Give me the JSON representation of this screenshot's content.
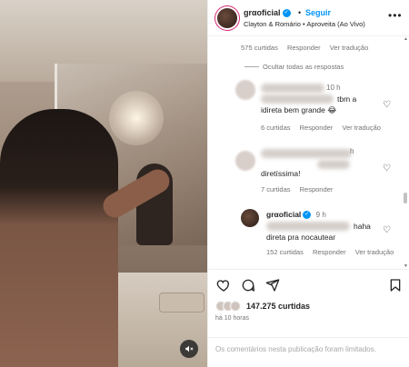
{
  "post": {
    "username": "grαoficial",
    "verified_mark": "✓",
    "separator": "•",
    "follow_label": "Seguir",
    "song": "Clayton & Romário • Aproveita (Ao Vivo)",
    "more_glyph": "•••"
  },
  "comments": {
    "prev_meta": {
      "likes": "575 curtidas",
      "reply": "Responder",
      "translate": "Ver tradução"
    },
    "hide_replies_label": "Ocultar todas as respostas",
    "items": [
      {
        "time": "10 h",
        "text_line1": "tbm a",
        "text_line2": "idireta bem grande 😂",
        "likes": "6 curtidas",
        "reply": "Responder",
        "translate": "Ver tradução"
      },
      {
        "time": "h",
        "text": "diretíssima!",
        "likes": "7 curtidas",
        "reply": "Responder"
      },
      {
        "username": "grαoficial",
        "verified_mark": "✓",
        "time": "9 h",
        "text_line1": "haha",
        "text_line2": "direta pra nocautear",
        "likes": "152 curtidas",
        "reply": "Responder",
        "translate": "Ver tradução"
      }
    ]
  },
  "actions": {
    "likes_count": "147.275 curtidas",
    "time_ago": "há 10 horas",
    "comments_limited": "Os comentários nesta publicação foram limitados."
  },
  "icons": {
    "heart": "♡",
    "mute": "🔇",
    "scroll_up": "▲",
    "scroll_down": "▼"
  },
  "colors": {
    "accent": "#0095f6",
    "text": "#262626",
    "secondary": "#737373",
    "border": "#efefef"
  }
}
